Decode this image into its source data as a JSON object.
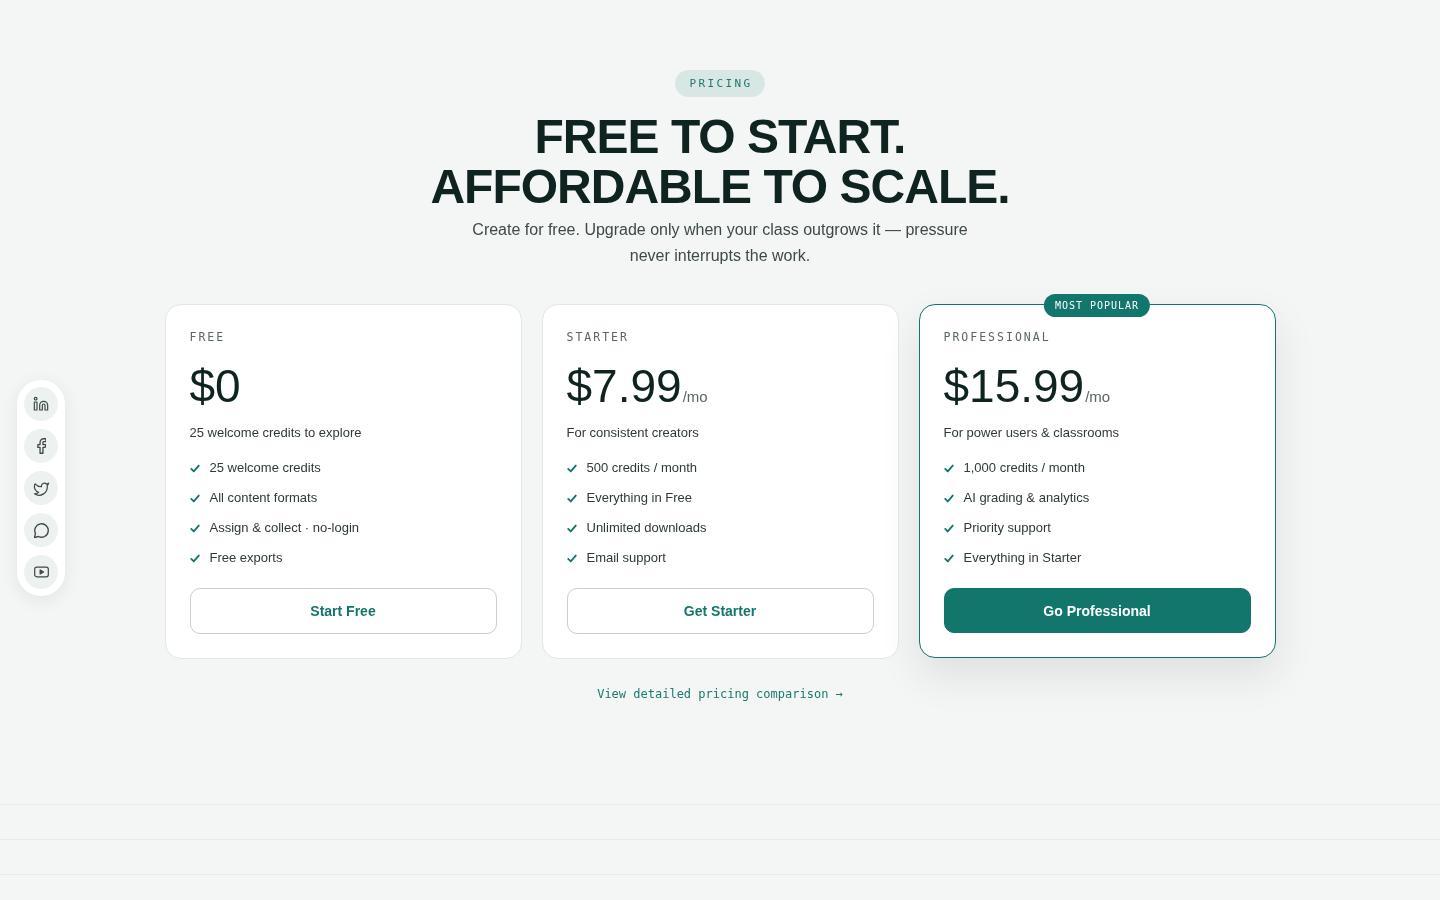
{
  "badge": "PRICING",
  "heading": [
    "FREE TO START.",
    "AFFORDABLE TO SCALE."
  ],
  "subtitle": "Create for free. Upgrade only when your class outgrows it — pressure never interrupts the work.",
  "plans": [
    {
      "tier": "FREE",
      "price": "$0",
      "description": "25 welcome credits to explore",
      "features": [
        "25 welcome credits",
        "All content formats",
        "Assign & collect · no-login",
        "Free exports"
      ],
      "button": "Start Free",
      "featured": false
    },
    {
      "tier": "STARTER",
      "price": "$7.99",
      "period": "/mo",
      "description": "For consistent creators",
      "features": [
        "500 credits / month",
        "Everything in Free",
        "Unlimited downloads",
        "Email support"
      ],
      "button": "Get Starter",
      "featured": false
    },
    {
      "tier": "PROFESSIONAL",
      "price": "$15.99",
      "period": "/mo",
      "ribbon": "MOST POPULAR",
      "description": "For power users & classrooms",
      "features": [
        "1,000 credits / month",
        "AI grading & analytics",
        "Priority support",
        "Everything in Starter"
      ],
      "button": "Go Professional",
      "featured": true
    }
  ],
  "comparison_link": "View detailed pricing comparison →"
}
